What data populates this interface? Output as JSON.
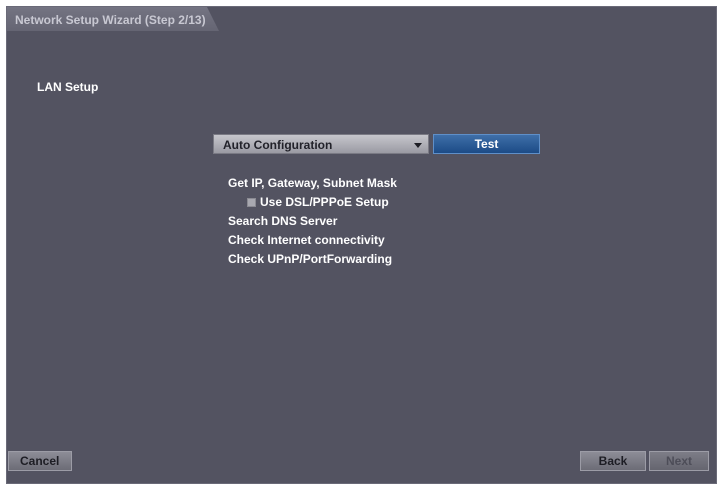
{
  "window": {
    "title": "Network Setup Wizard (Step 2/13)"
  },
  "section": {
    "label": "LAN Setup"
  },
  "config": {
    "mode_selected": "Auto Configuration",
    "test_label": "Test"
  },
  "checks": {
    "get_ip": "Get IP, Gateway, Subnet Mask",
    "dsl_option": "Use DSL/PPPoE Setup",
    "dns": "Search DNS Server",
    "internet": "Check Internet connectivity",
    "upnp": "Check UPnP/PortForwarding"
  },
  "footer": {
    "cancel_label": "Cancel",
    "back_label": "Back",
    "next_label": "Next"
  },
  "colors": {
    "panel_bg": "#535361",
    "accent_blue": "#1c4b86"
  },
  "icons": {
    "dropdown": "chevron-down-icon"
  }
}
